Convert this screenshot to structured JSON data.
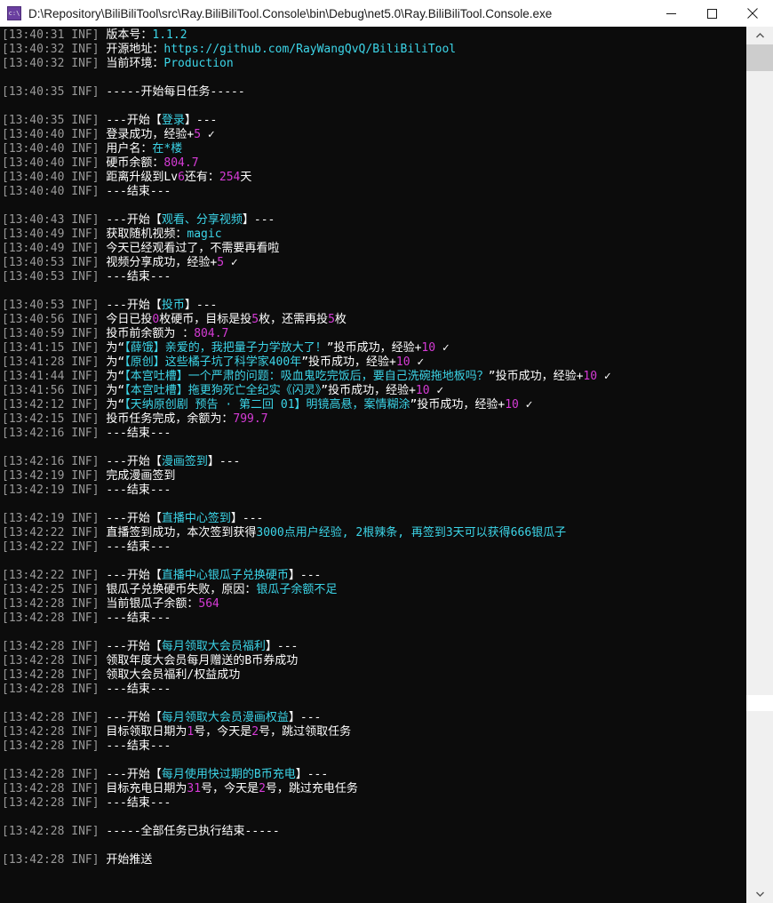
{
  "window": {
    "title": "D:\\Repository\\BiliBiliTool\\src\\Ray.BiliBiliTool.Console\\bin\\Debug\\net5.0\\Ray.BiliBiliTool.Console.exe",
    "icon_label": "c:\\",
    "minimize_label": "Minimize",
    "maximize_label": "Maximize",
    "close_label": "Close"
  },
  "scrollbar": {
    "up_arrow_label": "Scroll up",
    "down_arrow_label": "Scroll down"
  },
  "console": {
    "lines": [
      {
        "ts": "[13:40:31 INF]",
        "segs": [
          {
            "t": " 版本号：",
            "c": "w"
          },
          {
            "t": "1.1.2",
            "c": "c"
          }
        ]
      },
      {
        "ts": "[13:40:32 INF]",
        "segs": [
          {
            "t": " 开源地址：",
            "c": "w"
          },
          {
            "t": "https://github.com/RayWangQvQ/BiliBiliTool",
            "c": "c"
          }
        ]
      },
      {
        "ts": "[13:40:32 INF]",
        "segs": [
          {
            "t": " 当前环境：",
            "c": "w"
          },
          {
            "t": "Production",
            "c": "c"
          }
        ]
      },
      {
        "ts": "",
        "segs": []
      },
      {
        "ts": "[13:40:35 INF]",
        "segs": [
          {
            "t": " -----开始每日任务-----",
            "c": "w"
          }
        ]
      },
      {
        "ts": "",
        "segs": []
      },
      {
        "ts": "[13:40:35 INF]",
        "segs": [
          {
            "t": " ---开始【",
            "c": "w"
          },
          {
            "t": "登录",
            "c": "c"
          },
          {
            "t": "】---",
            "c": "w"
          }
        ]
      },
      {
        "ts": "[13:40:40 INF]",
        "segs": [
          {
            "t": " 登录成功，经验+",
            "c": "w"
          },
          {
            "t": "5",
            "c": "m"
          },
          {
            "t": " ✓",
            "c": "w"
          }
        ]
      },
      {
        "ts": "[13:40:40 INF]",
        "segs": [
          {
            "t": " 用户名：",
            "c": "w"
          },
          {
            "t": "在*楼",
            "c": "c"
          }
        ]
      },
      {
        "ts": "[13:40:40 INF]",
        "segs": [
          {
            "t": " 硬币余额：",
            "c": "w"
          },
          {
            "t": "804.7",
            "c": "m"
          }
        ]
      },
      {
        "ts": "[13:40:40 INF]",
        "segs": [
          {
            "t": " 距离升级到Lv",
            "c": "w"
          },
          {
            "t": "6",
            "c": "m"
          },
          {
            "t": "还有：",
            "c": "w"
          },
          {
            "t": "254",
            "c": "m"
          },
          {
            "t": "天",
            "c": "w"
          }
        ]
      },
      {
        "ts": "[13:40:40 INF]",
        "segs": [
          {
            "t": " ---结束---",
            "c": "w"
          }
        ]
      },
      {
        "ts": "",
        "segs": []
      },
      {
        "ts": "[13:40:43 INF]",
        "segs": [
          {
            "t": " ---开始【",
            "c": "w"
          },
          {
            "t": "观看、分享视频",
            "c": "c"
          },
          {
            "t": "】---",
            "c": "w"
          }
        ]
      },
      {
        "ts": "[13:40:49 INF]",
        "segs": [
          {
            "t": " 获取随机视频：",
            "c": "w"
          },
          {
            "t": "magic",
            "c": "c"
          }
        ]
      },
      {
        "ts": "[13:40:49 INF]",
        "segs": [
          {
            "t": " 今天已经观看过了，不需要再看啦",
            "c": "w"
          }
        ]
      },
      {
        "ts": "[13:40:53 INF]",
        "segs": [
          {
            "t": " 视频分享成功，经验+",
            "c": "w"
          },
          {
            "t": "5",
            "c": "m"
          },
          {
            "t": " ✓",
            "c": "w"
          }
        ]
      },
      {
        "ts": "[13:40:53 INF]",
        "segs": [
          {
            "t": " ---结束---",
            "c": "w"
          }
        ]
      },
      {
        "ts": "",
        "segs": []
      },
      {
        "ts": "[13:40:53 INF]",
        "segs": [
          {
            "t": " ---开始【",
            "c": "w"
          },
          {
            "t": "投币",
            "c": "c"
          },
          {
            "t": "】---",
            "c": "w"
          }
        ]
      },
      {
        "ts": "[13:40:56 INF]",
        "segs": [
          {
            "t": " 今日已投",
            "c": "w"
          },
          {
            "t": "0",
            "c": "m"
          },
          {
            "t": "枚硬币，目标是投",
            "c": "w"
          },
          {
            "t": "5",
            "c": "m"
          },
          {
            "t": "枚，还需再投",
            "c": "w"
          },
          {
            "t": "5",
            "c": "m"
          },
          {
            "t": "枚",
            "c": "w"
          }
        ]
      },
      {
        "ts": "[13:40:59 INF]",
        "segs": [
          {
            "t": " 投币前余额为 ：",
            "c": "w"
          },
          {
            "t": "804.7",
            "c": "m"
          }
        ]
      },
      {
        "ts": "[13:41:15 INF]",
        "segs": [
          {
            "t": " 为“",
            "c": "w"
          },
          {
            "t": "【薛饿】亲爱的，我把量子力学放大了！",
            "c": "c"
          },
          {
            "t": "”投币成功，经验+",
            "c": "w"
          },
          {
            "t": "10",
            "c": "m"
          },
          {
            "t": " ✓",
            "c": "w"
          }
        ]
      },
      {
        "ts": "[13:41:28 INF]",
        "segs": [
          {
            "t": " 为“",
            "c": "w"
          },
          {
            "t": "【原创】这些橘子坑了科学家400年",
            "c": "c"
          },
          {
            "t": "”投币成功，经验+",
            "c": "w"
          },
          {
            "t": "10",
            "c": "m"
          },
          {
            "t": " ✓",
            "c": "w"
          }
        ]
      },
      {
        "ts": "[13:41:44 INF]",
        "segs": [
          {
            "t": " 为“",
            "c": "w"
          },
          {
            "t": "【本宫吐槽】一个严肃的问题：吸血鬼吃完饭后，要自己洗碗拖地板吗？",
            "c": "c"
          },
          {
            "t": "”投币成功，经验+",
            "c": "w"
          },
          {
            "t": "10",
            "c": "m"
          },
          {
            "t": " ✓",
            "c": "w"
          }
        ]
      },
      {
        "ts": "[13:41:56 INF]",
        "segs": [
          {
            "t": " 为“",
            "c": "w"
          },
          {
            "t": "【本宫吐槽】拖更狗死亡全纪实《闪灵》",
            "c": "c"
          },
          {
            "t": "”投币成功，经验+",
            "c": "w"
          },
          {
            "t": "10",
            "c": "m"
          },
          {
            "t": " ✓",
            "c": "w"
          }
        ]
      },
      {
        "ts": "[13:42:12 INF]",
        "segs": [
          {
            "t": " 为“",
            "c": "w"
          },
          {
            "t": "【天纳原创剧 预告 · 第二回 01】明镜高悬，案情糊涂",
            "c": "c"
          },
          {
            "t": "”投币成功，经验+",
            "c": "w"
          },
          {
            "t": "10",
            "c": "m"
          },
          {
            "t": " ✓",
            "c": "w"
          }
        ]
      },
      {
        "ts": "[13:42:15 INF]",
        "segs": [
          {
            "t": " 投币任务完成，余额为：",
            "c": "w"
          },
          {
            "t": "799.7",
            "c": "m"
          }
        ]
      },
      {
        "ts": "[13:42:16 INF]",
        "segs": [
          {
            "t": " ---结束---",
            "c": "w"
          }
        ]
      },
      {
        "ts": "",
        "segs": []
      },
      {
        "ts": "[13:42:16 INF]",
        "segs": [
          {
            "t": " ---开始【",
            "c": "w"
          },
          {
            "t": "漫画签到",
            "c": "c"
          },
          {
            "t": "】---",
            "c": "w"
          }
        ]
      },
      {
        "ts": "[13:42:19 INF]",
        "segs": [
          {
            "t": " 完成漫画签到",
            "c": "w"
          }
        ]
      },
      {
        "ts": "[13:42:19 INF]",
        "segs": [
          {
            "t": " ---结束---",
            "c": "w"
          }
        ]
      },
      {
        "ts": "",
        "segs": []
      },
      {
        "ts": "[13:42:19 INF]",
        "segs": [
          {
            "t": " ---开始【",
            "c": "w"
          },
          {
            "t": "直播中心签到",
            "c": "c"
          },
          {
            "t": "】---",
            "c": "w"
          }
        ]
      },
      {
        "ts": "[13:42:22 INF]",
        "segs": [
          {
            "t": " 直播签到成功，本次签到获得",
            "c": "w"
          },
          {
            "t": "3000点用户经验, 2根辣条, 再签到3天可以获得666银瓜子",
            "c": "c"
          }
        ]
      },
      {
        "ts": "[13:42:22 INF]",
        "segs": [
          {
            "t": " ---结束---",
            "c": "w"
          }
        ]
      },
      {
        "ts": "",
        "segs": []
      },
      {
        "ts": "[13:42:22 INF]",
        "segs": [
          {
            "t": " ---开始【",
            "c": "w"
          },
          {
            "t": "直播中心银瓜子兑换硬币",
            "c": "c"
          },
          {
            "t": "】---",
            "c": "w"
          }
        ]
      },
      {
        "ts": "[13:42:25 INF]",
        "segs": [
          {
            "t": " 银瓜子兑换硬币失败，原因：",
            "c": "w"
          },
          {
            "t": "银瓜子余额不足",
            "c": "c"
          }
        ]
      },
      {
        "ts": "[13:42:28 INF]",
        "segs": [
          {
            "t": " 当前银瓜子余额：",
            "c": "w"
          },
          {
            "t": "564",
            "c": "m"
          }
        ]
      },
      {
        "ts": "[13:42:28 INF]",
        "segs": [
          {
            "t": " ---结束---",
            "c": "w"
          }
        ]
      },
      {
        "ts": "",
        "segs": []
      },
      {
        "ts": "[13:42:28 INF]",
        "segs": [
          {
            "t": " ---开始【",
            "c": "w"
          },
          {
            "t": "每月领取大会员福利",
            "c": "c"
          },
          {
            "t": "】---",
            "c": "w"
          }
        ]
      },
      {
        "ts": "[13:42:28 INF]",
        "segs": [
          {
            "t": " 领取年度大会员每月赠送的B币券成功",
            "c": "w"
          }
        ]
      },
      {
        "ts": "[13:42:28 INF]",
        "segs": [
          {
            "t": " 领取大会员福利/权益成功",
            "c": "w"
          }
        ]
      },
      {
        "ts": "[13:42:28 INF]",
        "segs": [
          {
            "t": " ---结束---",
            "c": "w"
          }
        ]
      },
      {
        "ts": "",
        "segs": []
      },
      {
        "ts": "[13:42:28 INF]",
        "segs": [
          {
            "t": " ---开始【",
            "c": "w"
          },
          {
            "t": "每月领取大会员漫画权益",
            "c": "c"
          },
          {
            "t": "】---",
            "c": "w"
          }
        ]
      },
      {
        "ts": "[13:42:28 INF]",
        "segs": [
          {
            "t": " 目标领取日期为",
            "c": "w"
          },
          {
            "t": "1",
            "c": "m"
          },
          {
            "t": "号，今天是",
            "c": "w"
          },
          {
            "t": "2",
            "c": "m"
          },
          {
            "t": "号，跳过领取任务",
            "c": "w"
          }
        ]
      },
      {
        "ts": "[13:42:28 INF]",
        "segs": [
          {
            "t": " ---结束---",
            "c": "w"
          }
        ]
      },
      {
        "ts": "",
        "segs": []
      },
      {
        "ts": "[13:42:28 INF]",
        "segs": [
          {
            "t": " ---开始【",
            "c": "w"
          },
          {
            "t": "每月使用快过期的B币充电",
            "c": "c"
          },
          {
            "t": "】---",
            "c": "w"
          }
        ]
      },
      {
        "ts": "[13:42:28 INF]",
        "segs": [
          {
            "t": " 目标充电日期为",
            "c": "w"
          },
          {
            "t": "31",
            "c": "m"
          },
          {
            "t": "号，今天是",
            "c": "w"
          },
          {
            "t": "2",
            "c": "m"
          },
          {
            "t": "号，跳过充电任务",
            "c": "w"
          }
        ]
      },
      {
        "ts": "[13:42:28 INF]",
        "segs": [
          {
            "t": " ---结束---",
            "c": "w"
          }
        ]
      },
      {
        "ts": "",
        "segs": []
      },
      {
        "ts": "[13:42:28 INF]",
        "segs": [
          {
            "t": " -----全部任务已执行结束-----",
            "c": "w"
          }
        ]
      },
      {
        "ts": "",
        "segs": []
      },
      {
        "ts": "[13:42:28 INF]",
        "segs": [
          {
            "t": " 开始推送",
            "c": "w"
          }
        ]
      }
    ]
  }
}
